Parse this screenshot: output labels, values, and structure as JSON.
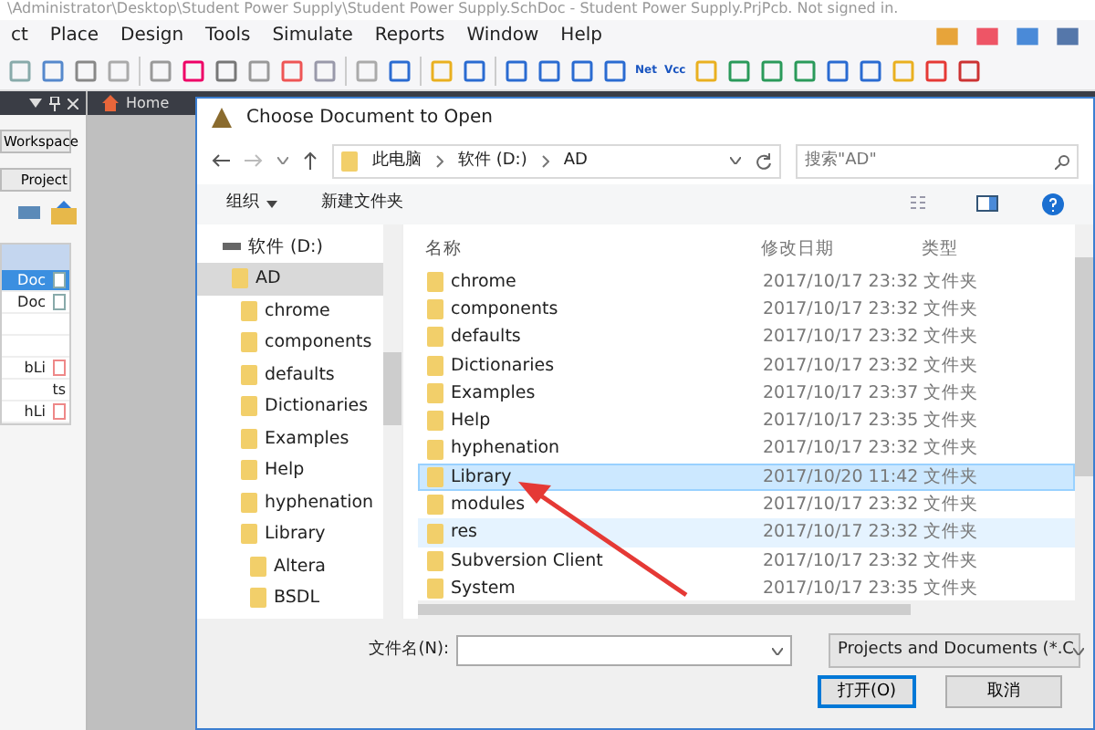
{
  "window": {
    "title": "\\Administrator\\Desktop\\Student Power Supply\\Student Power Supply.SchDoc - Student Power Supply.PrjPcb. Not signed in."
  },
  "menu": [
    "ct",
    "Place",
    "Design",
    "Tools",
    "Simulate",
    "Reports",
    "Window",
    "Help"
  ],
  "toolbar_labels": [
    "Net",
    "Vcc"
  ],
  "doc_tabs": [
    {
      "label": "Home"
    }
  ],
  "panel": {
    "buttons": [
      "Workspace",
      "Project"
    ],
    "files": [
      {
        "label": "Doc",
        "kind": "schematic",
        "selected": true
      },
      {
        "label": "Doc",
        "kind": "schematic",
        "selected": false
      },
      {
        "kind": "blank",
        "selected": false
      },
      {
        "kind": "blank",
        "selected": false
      },
      {
        "label": "bLi",
        "kind": "library",
        "selected": false
      },
      {
        "label": "ts",
        "kind": "plain",
        "selected": false
      },
      {
        "label": "hLi",
        "kind": "library",
        "selected": false
      }
    ]
  },
  "dialog": {
    "title": "Choose Document to Open",
    "breadcrumb": [
      "此电脑",
      "软件 (D:)",
      "AD"
    ],
    "search": {
      "placeholder": "搜索\"AD\""
    },
    "commands": [
      {
        "label": "组织",
        "kind": "menu"
      },
      {
        "label": "新建文件夹",
        "kind": "plain"
      }
    ],
    "tree": [
      {
        "label": "软件 (D:)",
        "kind": "drive",
        "selected": false,
        "children": [
          {
            "label": "AD",
            "kind": "folder",
            "selected": true,
            "children": [
              {
                "label": "chrome",
                "kind": "folder",
                "selected": false
              },
              {
                "label": "components",
                "kind": "folder",
                "selected": false
              },
              {
                "label": "defaults",
                "kind": "folder",
                "selected": false
              },
              {
                "label": "Dictionaries",
                "kind": "folder",
                "selected": false
              },
              {
                "label": "Examples",
                "kind": "folder",
                "selected": false
              },
              {
                "label": "Help",
                "kind": "folder",
                "selected": false
              },
              {
                "label": "hyphenation",
                "kind": "folder",
                "selected": false
              },
              {
                "label": "Library",
                "kind": "folder",
                "selected": false,
                "children": [
                  {
                    "label": "Altera",
                    "kind": "folder",
                    "selected": false
                  },
                  {
                    "label": "BSDL",
                    "kind": "folder",
                    "selected": false
                  }
                ]
              }
            ]
          }
        ]
      }
    ],
    "columns": [
      "名称",
      "修改日期",
      "类型"
    ],
    "files": [
      {
        "name": "chrome",
        "modified": "2017/10/17 23:32",
        "type": "文件夹",
        "selected": false,
        "hovered": false
      },
      {
        "name": "components",
        "modified": "2017/10/17 23:32",
        "type": "文件夹",
        "selected": false,
        "hovered": false
      },
      {
        "name": "defaults",
        "modified": "2017/10/17 23:32",
        "type": "文件夹",
        "selected": false,
        "hovered": false
      },
      {
        "name": "Dictionaries",
        "modified": "2017/10/17 23:32",
        "type": "文件夹",
        "selected": false,
        "hovered": false
      },
      {
        "name": "Examples",
        "modified": "2017/10/17 23:37",
        "type": "文件夹",
        "selected": false,
        "hovered": false
      },
      {
        "name": "Help",
        "modified": "2017/10/17 23:35",
        "type": "文件夹",
        "selected": false,
        "hovered": false
      },
      {
        "name": "hyphenation",
        "modified": "2017/10/17 23:32",
        "type": "文件夹",
        "selected": false,
        "hovered": false
      },
      {
        "name": "Library",
        "modified": "2017/10/20 11:42",
        "type": "文件夹",
        "selected": true,
        "hovered": false
      },
      {
        "name": "modules",
        "modified": "2017/10/17 23:32",
        "type": "文件夹",
        "selected": false,
        "hovered": false
      },
      {
        "name": "res",
        "modified": "2017/10/17 23:32",
        "type": "文件夹",
        "selected": false,
        "hovered": true
      },
      {
        "name": "Subversion Client",
        "modified": "2017/10/17 23:32",
        "type": "文件夹",
        "selected": false,
        "hovered": false
      },
      {
        "name": "System",
        "modified": "2017/10/17 23:35",
        "type": "文件夹",
        "selected": false,
        "hovered": false
      }
    ],
    "filename_label": "文件名(N):",
    "filetype": "Projects and Documents (*.C",
    "buttons": [
      {
        "label": "打开(O)",
        "kind": "default"
      },
      {
        "label": "取消",
        "kind": "normal"
      }
    ]
  }
}
